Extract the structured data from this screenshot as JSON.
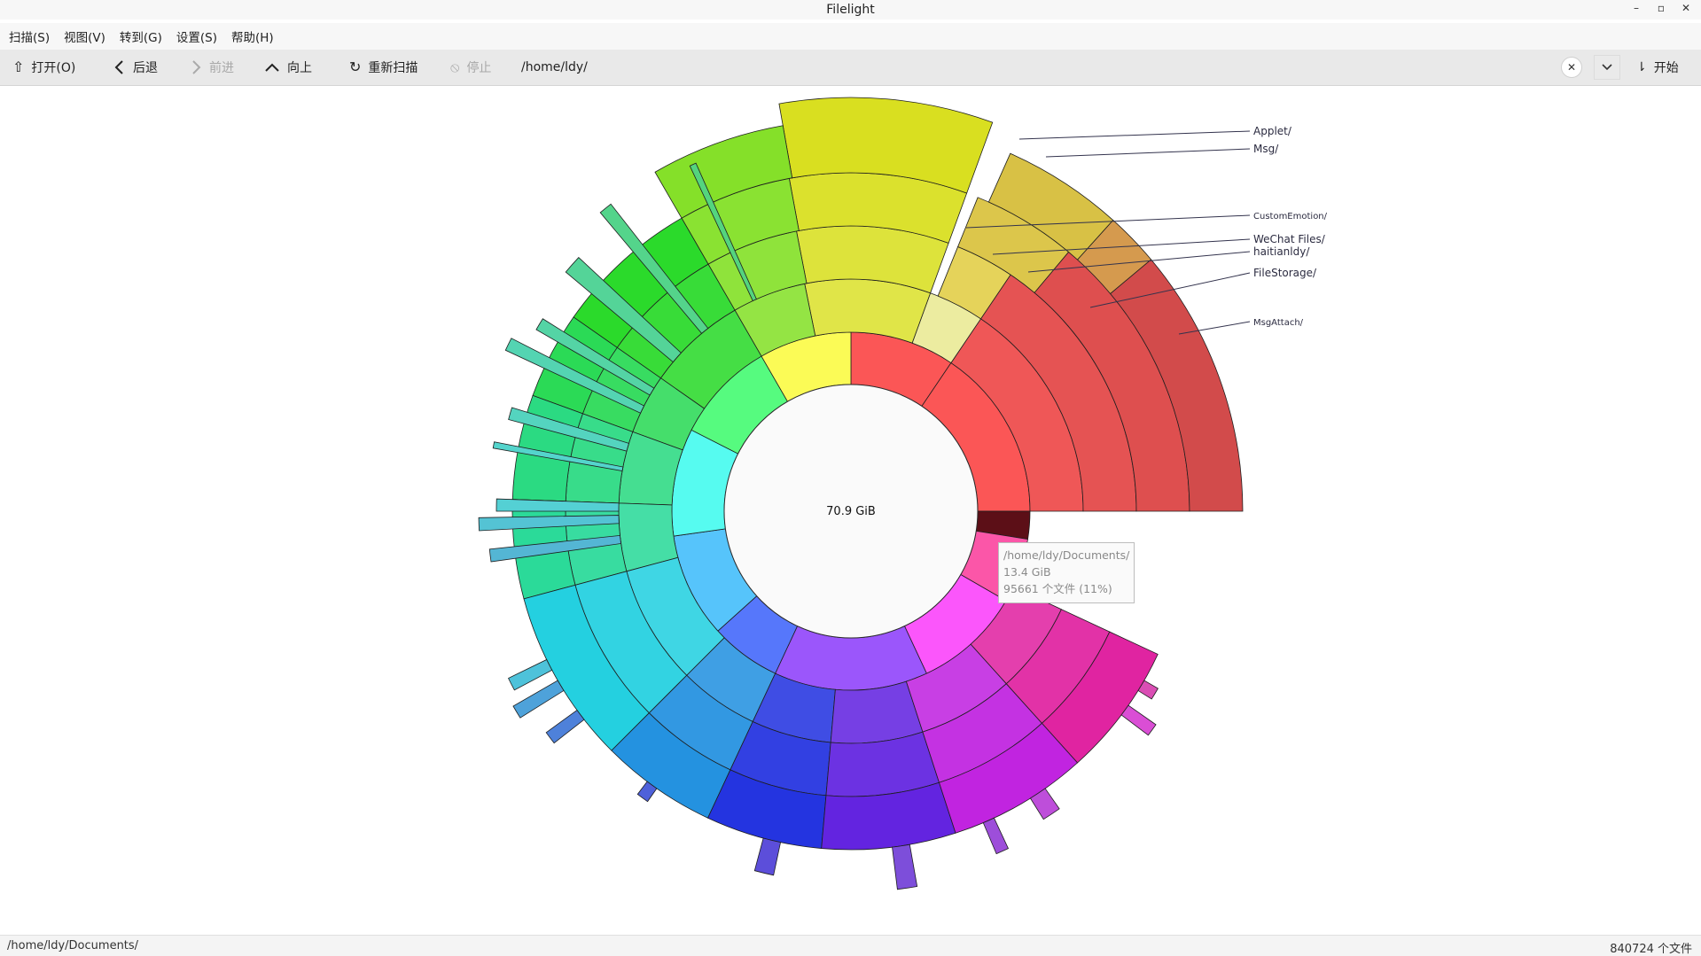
{
  "window": {
    "title": "Filelight"
  },
  "menu": [
    {
      "label": "扫描(S)"
    },
    {
      "label": "视图(V)"
    },
    {
      "label": "转到(G)"
    },
    {
      "label": "设置(S)"
    },
    {
      "label": "帮助(H)"
    }
  ],
  "toolbar": {
    "open": "打开(O)",
    "back": "后退",
    "forward": "前进",
    "up": "向上",
    "rescan": "重新扫描",
    "stop": "停止",
    "path": "/home/ldy/",
    "start": "开始"
  },
  "chart": {
    "center_label": "70.9 GiB",
    "callouts": [
      "Applet/",
      "Msg/",
      "CustomEmotion/",
      "WeChat Files/",
      "haitianldy/",
      "FileStorage/",
      "MsgAttach/"
    ]
  },
  "tooltip": {
    "path": "/home/ldy/Documents/",
    "size": "13.4 GiB",
    "files": "95661 个文件 (11%)"
  },
  "status": {
    "left": "/home/ldy/Documents/",
    "right": "840724 个文件"
  },
  "icons": {
    "open": "upload-icon",
    "back": "chevron-left-icon",
    "forward": "chevron-right-icon",
    "up": "chevron-up-icon",
    "rescan": "refresh-icon",
    "stop": "stop-icon",
    "clear": "close-icon",
    "dropdown": "chevron-down-icon",
    "start": "start-icon"
  }
}
